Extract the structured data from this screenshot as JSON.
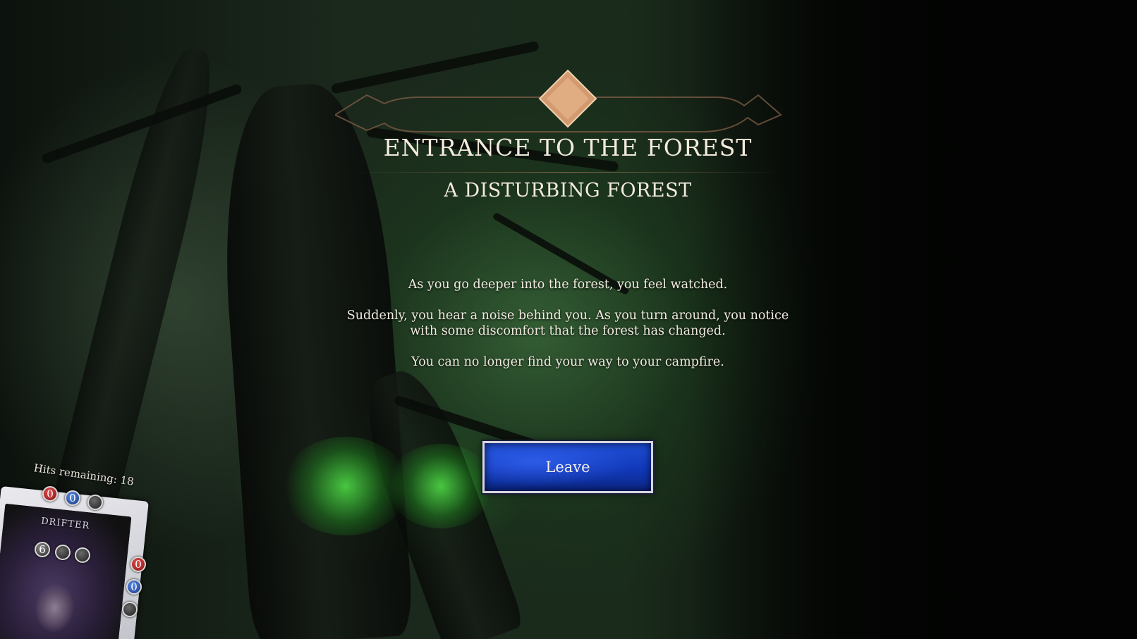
{
  "event": {
    "title": "ENTRANCE TO THE FOREST",
    "subtitle": "A DISTURBING FOREST",
    "paragraphs": [
      "As you go deeper into the forest, you feel watched.",
      "Suddenly, you hear a noise behind you. As you turn around, you notice with some discomfort that the forest has changed.",
      "You can no longer find your way to your campfire."
    ]
  },
  "actions": {
    "leave_label": "Leave"
  },
  "character": {
    "hits_remaining": "Hits remaining: 18",
    "name": "DRIFTER",
    "top_stats": [
      "0",
      "0",
      ""
    ],
    "side_stats": [
      "0",
      "0",
      ""
    ],
    "card_stat": "6"
  },
  "colors": {
    "button_blue": "#1138b8",
    "title_text": "#f3ebdd",
    "forest_glow": "#5aff50"
  }
}
